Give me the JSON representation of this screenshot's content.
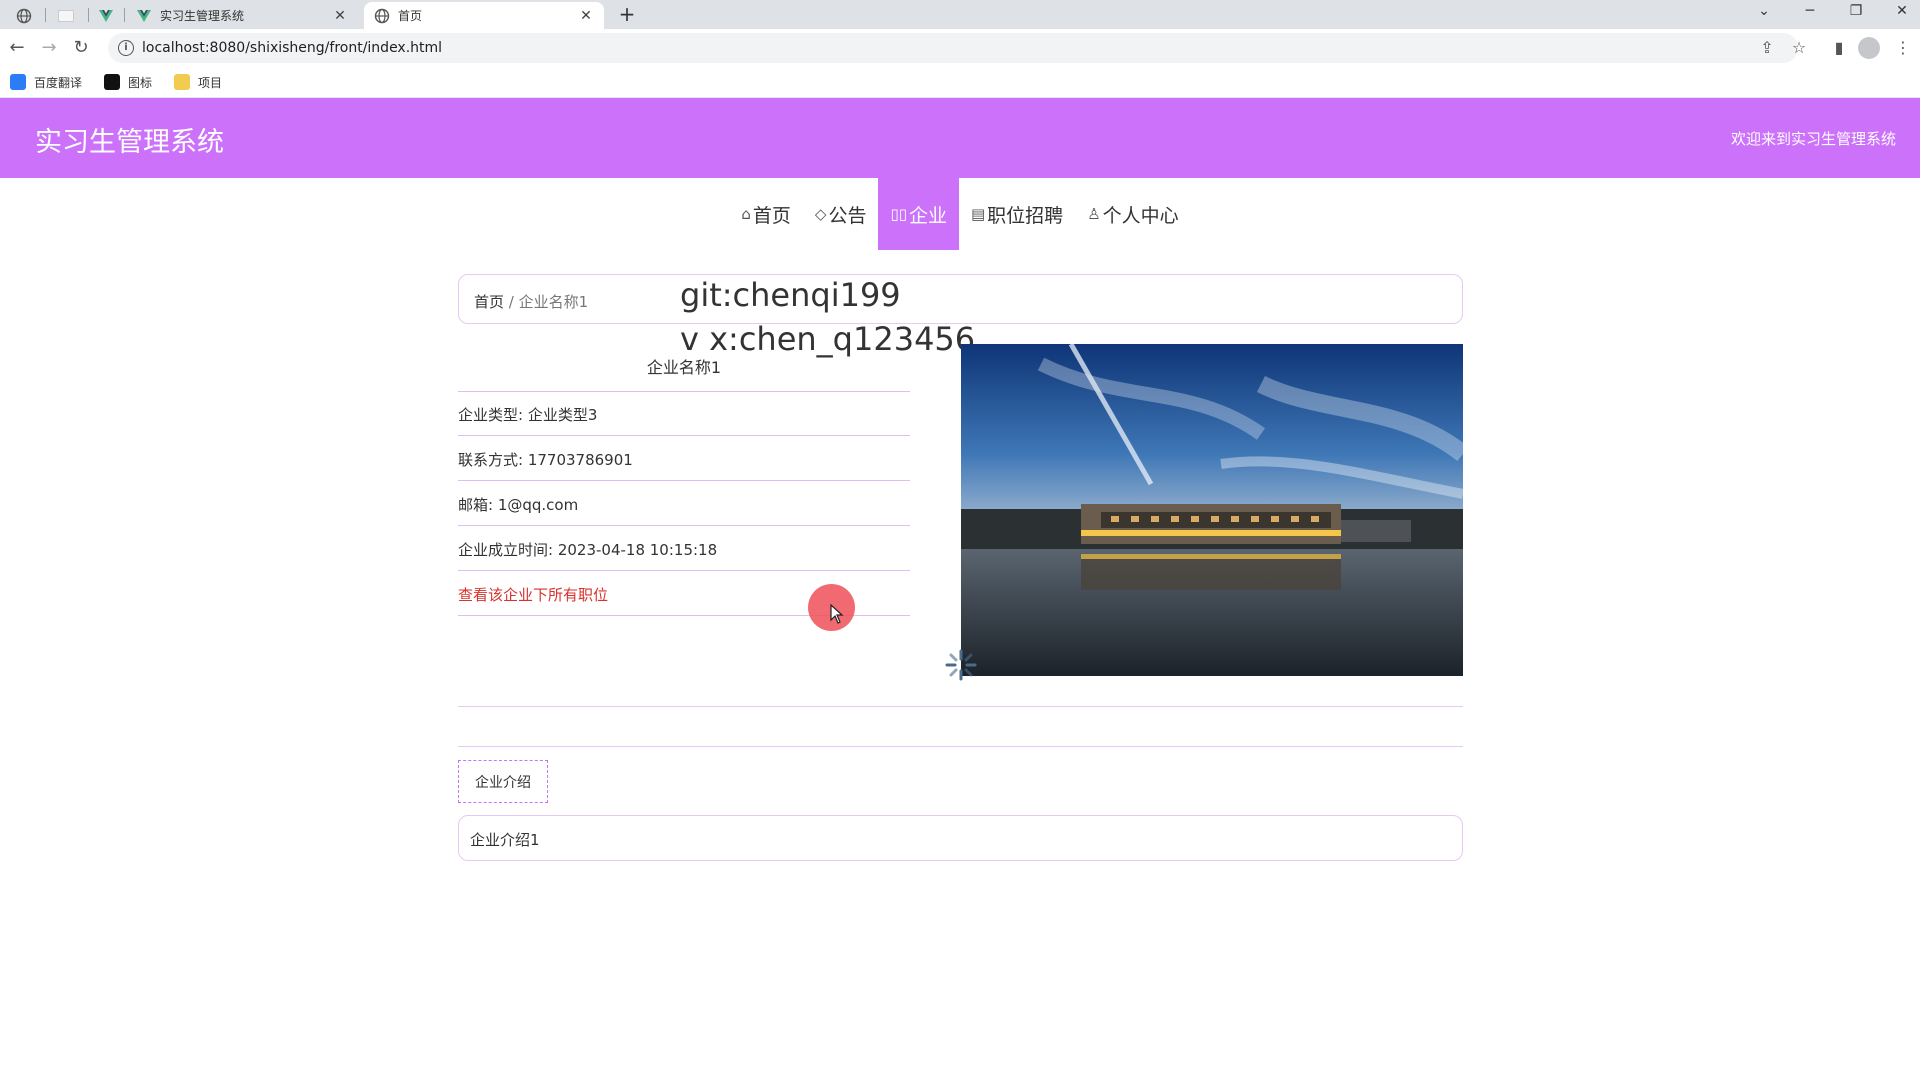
{
  "browser": {
    "tabs": [
      {
        "title": "实习生管理系统",
        "active": false
      },
      {
        "title": "首页",
        "active": true
      }
    ],
    "url": "localhost:8080/shixisheng/front/index.html",
    "bookmarks": [
      {
        "label": "百度翻译"
      },
      {
        "label": "图标"
      },
      {
        "label": "项目"
      }
    ]
  },
  "header": {
    "site_title": "实习生管理系统",
    "welcome": "欢迎来到实习生管理系统",
    "bg_color": "#cb71fa"
  },
  "nav": {
    "items": [
      {
        "label": "首页",
        "icon": "home-icon",
        "active": false
      },
      {
        "label": "公告",
        "icon": "tag-icon",
        "active": false
      },
      {
        "label": "企业",
        "icon": "company-icon",
        "active": true
      },
      {
        "label": "职位招聘",
        "icon": "calendar-icon",
        "active": false
      },
      {
        "label": "个人中心",
        "icon": "user-icon",
        "active": false
      }
    ]
  },
  "breadcrumb": {
    "home": "首页",
    "separator": " / ",
    "current": "企业名称1"
  },
  "watermark": {
    "line1": "git:chenqi199",
    "line2": "v x:chen_q123456"
  },
  "company": {
    "name": "企业名称1",
    "type_label": "企业类型: 企业类型3",
    "phone_label": "联系方式: 17703786901",
    "email_label": "邮箱: 1@qq.com",
    "founded_label": "企业成立时间: 2023-04-18 10:15:18",
    "jobs_link": "查看该企业下所有职位"
  },
  "intro": {
    "tab_label": "企业介绍",
    "content": "企业介绍1"
  }
}
